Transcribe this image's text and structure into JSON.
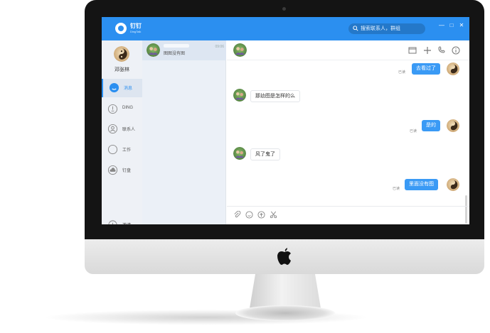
{
  "app": {
    "name": "钉钉",
    "subtitle": "DingTalk",
    "search_placeholder": "搜索联系人，群组",
    "window_controls": {
      "minimize": "—",
      "maximize": "□",
      "close": "✕"
    }
  },
  "sidebar": {
    "user_name": "邓张林",
    "items": [
      {
        "label": "消息",
        "icon": "chat-bubble-icon",
        "active": true
      },
      {
        "label": "DING",
        "icon": "ding-bell-icon",
        "active": false
      },
      {
        "label": "联系人",
        "icon": "contacts-icon",
        "active": false
      },
      {
        "label": "工作",
        "icon": "work-compass-icon",
        "active": false
      },
      {
        "label": "钉盘",
        "icon": "cloud-drive-icon",
        "active": false
      }
    ],
    "bottom_item": "邀请"
  },
  "conversations": [
    {
      "preview": "图图没有图",
      "time": "09:06"
    }
  ],
  "chat": {
    "header_icons": [
      "window-icon",
      "add-icon",
      "call-icon",
      "info-icon"
    ],
    "messages": [
      {
        "direction": "out",
        "text": "去看过了",
        "status": "已读"
      },
      {
        "direction": "in",
        "text": "那幼图是怎样的么"
      },
      {
        "direction": "out",
        "text": "是的",
        "status": "已读"
      },
      {
        "direction": "in",
        "text": "风了鬼了"
      },
      {
        "direction": "out",
        "text": "里面没有图",
        "status": "已读"
      }
    ],
    "toolbar_icons": [
      "attachment-icon",
      "emoji-icon",
      "cloud-upload-icon",
      "scissors-icon"
    ]
  },
  "colors": {
    "accent": "#2b8ff0",
    "bubble_out": "#3a9af5",
    "nav_bg": "#eef1f6"
  }
}
